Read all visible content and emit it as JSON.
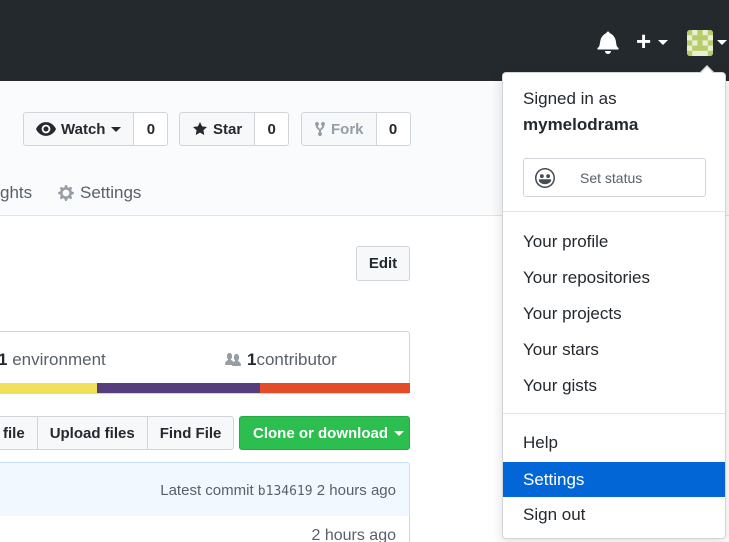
{
  "header": {
    "bell_icon": "bell-icon",
    "plus_icon": "plus-icon",
    "avatar_icon": "avatar"
  },
  "repo": {
    "watch": {
      "label": "Watch",
      "count": "0"
    },
    "star": {
      "label": "Star",
      "count": "0"
    },
    "fork": {
      "label": "Fork",
      "count": "0"
    },
    "tabs": {
      "insights_partial": "ghts",
      "settings": "Settings"
    },
    "edit_label": "Edit",
    "summary": {
      "env_count": "1",
      "env_label": " environment",
      "contrib_count": "1",
      "contrib_label": " contributor"
    },
    "lang_colors": [
      "#f1e05a",
      "#563d7c",
      "#e34c26"
    ],
    "file_buttons": [
      "file",
      "Upload files",
      "Find File"
    ],
    "clone_label": "Clone or download",
    "latest_commit_label": "Latest commit",
    "commit_hash": "b134619",
    "commit_time": "2 hours ago",
    "file_row_time": "2 hours ago"
  },
  "dropdown": {
    "signed_in_as": "Signed in as",
    "username": "mymelodrama",
    "set_status": "Set status",
    "items_group1": [
      "Your profile",
      "Your repositories",
      "Your projects",
      "Your stars",
      "Your gists"
    ],
    "items_group2": [
      "Help",
      "Settings",
      "Sign out"
    ],
    "active_item": "Settings"
  },
  "colors": {
    "header_bg": "#24292e",
    "accent_blue": "#0366d6",
    "clone_green": "#2cbe4e"
  }
}
